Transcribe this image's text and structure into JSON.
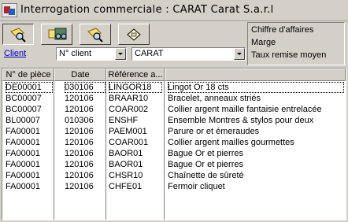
{
  "window": {
    "title": "Interrogation commerciale : CARAT Carat S.a.r.l"
  },
  "toolbar": {
    "buttons": [
      {
        "name": "search-icon",
        "pressed": true
      },
      {
        "name": "binoculars-icon",
        "pressed": false
      },
      {
        "name": "search-icon",
        "pressed": false
      },
      {
        "name": "document-icon",
        "pressed": false
      }
    ]
  },
  "filter": {
    "client_link": "Client",
    "field_combo": "N° client",
    "value_combo": "CARAT"
  },
  "summary": {
    "line1": "Chiffre d'affaires",
    "line2": "Marge",
    "line3": "Taux remise moyen"
  },
  "table": {
    "columns": [
      "N° de pièce",
      "Date",
      "Référence a...",
      ""
    ],
    "rows": [
      [
        "DE00001",
        "030106",
        "LINGOR18",
        "Lingot Or 18 cts"
      ],
      [
        "BC00007",
        "120106",
        "BRAAR10",
        "Bracelet, anneaux striés"
      ],
      [
        "BC00007",
        "120106",
        "COAR002",
        "Collier argent maille fantaisie entrelacée"
      ],
      [
        "BL00007",
        "010306",
        "ENSHF",
        "Ensemble Montres & stylos pour deux"
      ],
      [
        "FA00001",
        "120106",
        "PAEM001",
        "Parure or et émeraudes"
      ],
      [
        "FA00001",
        "120106",
        "COAR001",
        "Collier argent mailles gourmettes"
      ],
      [
        "FA00001",
        "120106",
        "BAOR01",
        "Bague Or et pierres"
      ],
      [
        "FA00001",
        "120106",
        "BAOR01",
        "Bague Or et pierres"
      ],
      [
        "FA00001",
        "120106",
        "CHSR10",
        "Chaînette de sûreté"
      ],
      [
        "FA00001",
        "120106",
        "CHFE01",
        "Fermoir cliquet"
      ]
    ]
  }
}
